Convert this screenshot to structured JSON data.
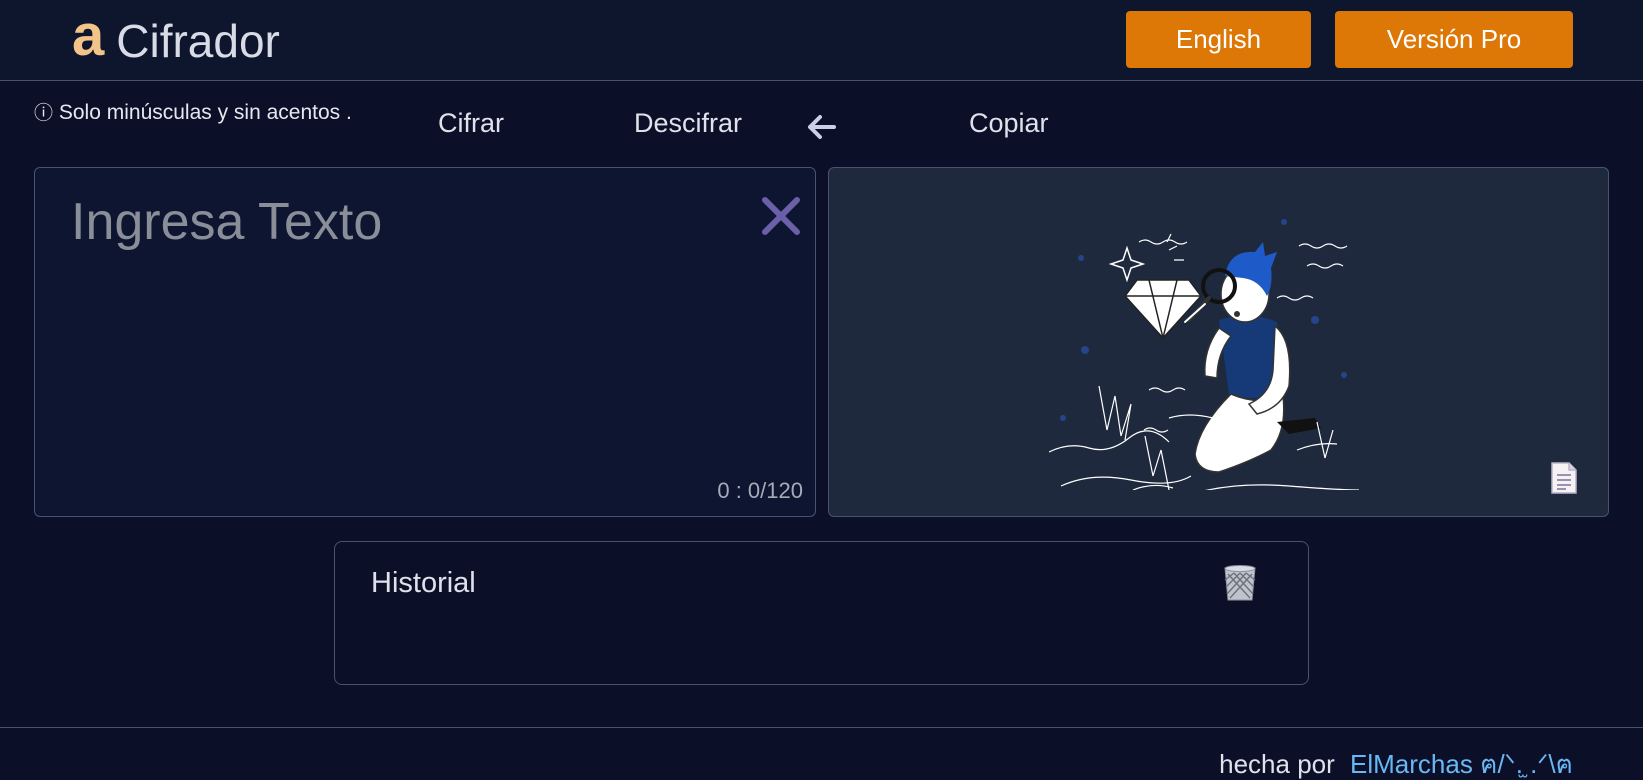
{
  "header": {
    "logo_mark": "a",
    "logo_text": "Cifrador",
    "english_label": "English",
    "pro_label": "Versión Pro"
  },
  "toolbar": {
    "note_icon": "ⓘ",
    "note_text": "Solo minúsculas y sin acentos .",
    "encrypt_label": "Cifrar",
    "decrypt_label": "Descifrar",
    "swap_icon": "arrow-left-icon",
    "copy_label": "Copiar"
  },
  "input": {
    "placeholder": "Ingresa Texto",
    "counter": "0 : 0/120"
  },
  "output": {
    "illustration": "person-examining-diamond-illustration",
    "doc_icon": "document-icon"
  },
  "history": {
    "title": "Historial",
    "clear_icon": "trash-icon"
  },
  "footer": {
    "prefix": "hecha por",
    "author": "ElMarchas ฅ/ᐠ.̫ .ᐟ\\ฅ"
  },
  "colors": {
    "background": "#0b1028",
    "accent": "#dd7705",
    "logo": "#f2c48a",
    "link": "#6ab7f5",
    "clear": "#6a5fa8"
  }
}
